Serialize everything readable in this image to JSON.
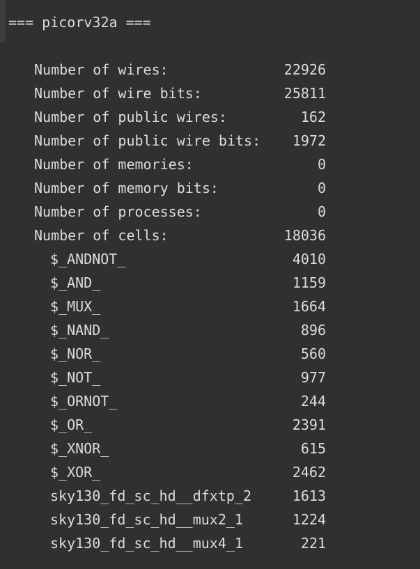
{
  "header": "=== picorv32a ===",
  "stats": [
    {
      "label": "Number of wires:",
      "value": "22926"
    },
    {
      "label": "Number of wire bits:",
      "value": "25811"
    },
    {
      "label": "Number of public wires:",
      "value": "162"
    },
    {
      "label": "Number of public wire bits:",
      "value": "1972"
    },
    {
      "label": "Number of memories:",
      "value": "0"
    },
    {
      "label": "Number of memory bits:",
      "value": "0"
    },
    {
      "label": "Number of processes:",
      "value": "0"
    },
    {
      "label": "Number of cells:",
      "value": "18036"
    }
  ],
  "cells": [
    {
      "label": "$_ANDNOT_",
      "value": "4010"
    },
    {
      "label": "$_AND_",
      "value": "1159"
    },
    {
      "label": "$_MUX_",
      "value": "1664"
    },
    {
      "label": "$_NAND_",
      "value": "896"
    },
    {
      "label": "$_NOR_",
      "value": "560"
    },
    {
      "label": "$_NOT_",
      "value": "977"
    },
    {
      "label": "$_ORNOT_",
      "value": "244"
    },
    {
      "label": "$_OR_",
      "value": "2391"
    },
    {
      "label": "$_XNOR_",
      "value": "615"
    },
    {
      "label": "$_XOR_",
      "value": "2462"
    },
    {
      "label": "sky130_fd_sc_hd__dfxtp_2",
      "value": "1613"
    },
    {
      "label": "sky130_fd_sc_hd__mux2_1",
      "value": "1224"
    },
    {
      "label": "sky130_fd_sc_hd__mux4_1",
      "value": "221"
    }
  ]
}
